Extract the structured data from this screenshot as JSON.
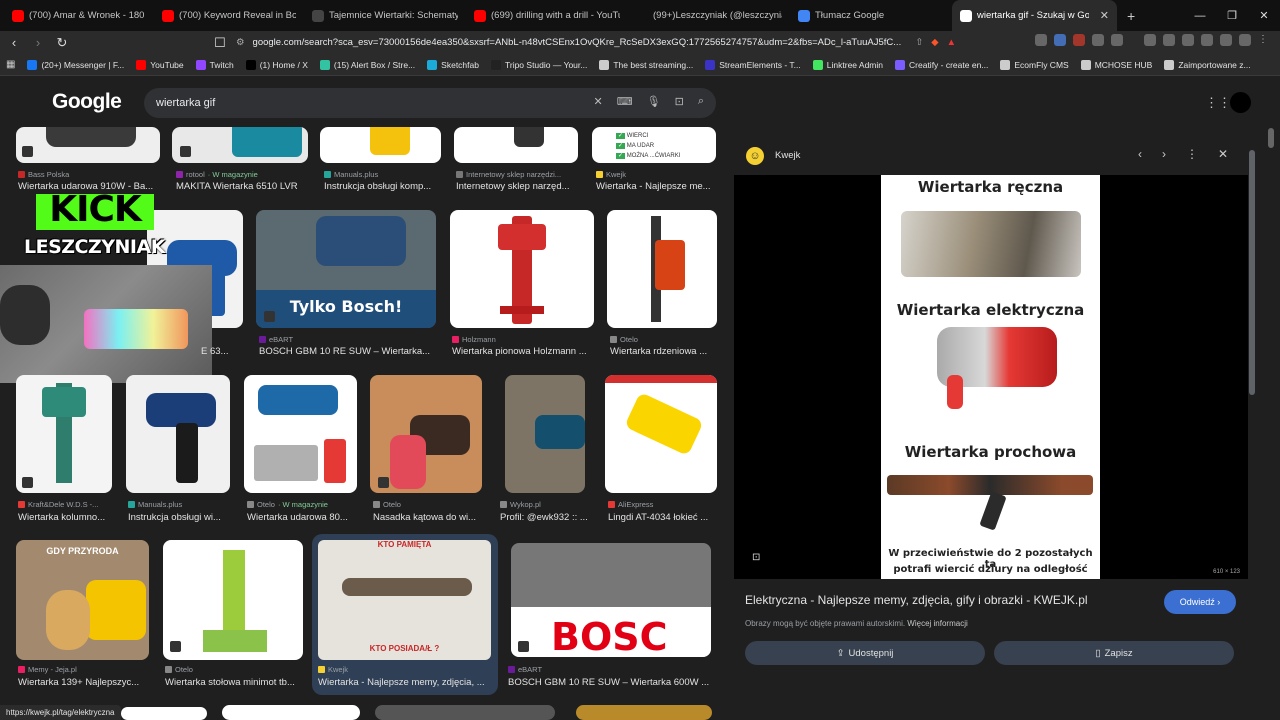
{
  "tabs": [
    {
      "label": "(700) Amar & Wronek - 180 Stop",
      "color": "#ff0000",
      "active": false
    },
    {
      "label": "(700) Keyword Reveal in Book effect",
      "color": "#ff0000",
      "active": false
    },
    {
      "label": "Tajemnice Wiertarki: Schematy, Fizyk",
      "color": "#444444",
      "active": false
    },
    {
      "label": "(699) drilling with a drill - YouTube",
      "color": "#ff0000",
      "active": false
    },
    {
      "label": "(99+)Leszczyniak (@leszczyniak1) | T",
      "color": "#111111",
      "active": false
    },
    {
      "label": "Tłumacz Google",
      "color": "#4285f4",
      "active": false
    },
    {
      "label": "wiertarka gif - Szukaj w Google",
      "color": "#ffffff",
      "active": true
    }
  ],
  "address": {
    "url": "google.com/search?sca_esv=73000156de4ea350&sxsrf=ANbL-n48vtCSEnx1OvQKre_RcSeDX3exGQ:1772565274757&udm=2&fbs=ADc_l-aTuuAJ5fC..."
  },
  "bookmarks": [
    {
      "label": "(20+) Messenger | F...",
      "color": "#1877f2"
    },
    {
      "label": "YouTube",
      "color": "#ff0000"
    },
    {
      "label": "Twitch",
      "color": "#9146ff"
    },
    {
      "label": "(1) Home / X",
      "color": "#000000"
    },
    {
      "label": "(15) Alert Box / Stre...",
      "color": "#31c3a2"
    },
    {
      "label": "Sketchfab",
      "color": "#1caad9"
    },
    {
      "label": "Tripo Studio — Your...",
      "color": "#222222"
    },
    {
      "label": "The best streaming...",
      "color": "#cccccc"
    },
    {
      "label": "StreamElements - T...",
      "color": "#3b32c6"
    },
    {
      "label": "Linktree Admin",
      "color": "#43e660"
    },
    {
      "label": "Creatify - create en...",
      "color": "#7a5cff"
    },
    {
      "label": "EcomFly CMS",
      "color": "#cccccc"
    },
    {
      "label": "MCHOSE HUB",
      "color": "#cccccc"
    },
    {
      "label": "Zaimportowane z...",
      "color": "#cccccc"
    }
  ],
  "search": {
    "logo": "Google",
    "query": "wiertarka gif"
  },
  "overlay": {
    "kick": "KICK",
    "name": "LESZCZYNIAK"
  },
  "results": {
    "row1": [
      {
        "source": "Bass Polska",
        "title": "Wiertarka udarowa 910W - Ba..."
      },
      {
        "source": "rotool",
        "mag": "· W magazynie",
        "title": "MAKITA Wiertarka 6510 LVR"
      },
      {
        "source": "Manuals.plus",
        "title": "Instrukcja obsługi komp..."
      },
      {
        "source": "Internetowy sklep narzędzi...",
        "title": "Internetowy sklep narzęd..."
      },
      {
        "source": "Kwejk",
        "title": "Wiertarka - Najlepsze me..."
      }
    ],
    "row2": [
      {
        "source": "",
        "title": "E 63..."
      },
      {
        "source": "eBART",
        "title": "BOSCH GBM 10 RE SUW – Wiertarka..."
      },
      {
        "source": "Holzmann",
        "title": "Wiertarka pionowa Holzmann ..."
      },
      {
        "source": "Otelo",
        "title": "Wiertarka rdzeniowa ..."
      }
    ],
    "row2_banner": "Tylko Bosch!",
    "row3": [
      {
        "source": "Kraft&Dele W.D.S -...",
        "title": "Wiertarka kolumno..."
      },
      {
        "source": "Manuals.plus",
        "title": "Instrukcja obsługi wi..."
      },
      {
        "source": "Otelo",
        "mag": "· W magazynie",
        "title": "Wiertarka udarowa 80..."
      },
      {
        "source": "Otelo",
        "title": "Nasadka kątowa do wi..."
      },
      {
        "source": "Wykop.pl",
        "title": "Profil: @ewk932 :: ..."
      },
      {
        "source": "AliExpress",
        "title": "Lingdi AT-4034 łokieć ..."
      }
    ],
    "row4": [
      {
        "source": "Memy - Jeja.pl",
        "title": "Wiertarka 139+ Najlepszyc..."
      },
      {
        "source": "Otelo",
        "title": "Wiertarka stołowa minimot tb..."
      },
      {
        "source": "Kwejk",
        "title": "Wiertarka - Najlepsze memy, zdjęcia, ..."
      },
      {
        "source": "eBART",
        "title": "BOSCH GBM 10 RE SUW – Wiertarka 600W ..."
      }
    ],
    "row4_texts": {
      "gdy": "GDY PRZYRODA",
      "kto_top": "KTO PAMIĘTA",
      "kto_bottom": "KTO POSIADA/Ł ?",
      "bosch": "BOSC"
    },
    "row1_check": [
      "WIERCI",
      "MA UDAR",
      "MOŻNA ...ĆWIARKI"
    ]
  },
  "panel": {
    "site": "Kwejk",
    "meme": {
      "line1": "Wiertarka ręczna",
      "line2": "Wiertarka elektryczna",
      "line3": "Wiertarka prochowa",
      "line4": "W przeciwieństwie do 2 pozostałych ta",
      "line5": "potrafi wiercić dziury na odległość"
    },
    "dims": "610 × 123",
    "title": "Elektryczna - Najlepsze memy, zdjęcia, gify i obrazki - KWEJK.pl",
    "visit": "Odwiedź",
    "rights": "Obrazy mogą być objęte prawami autorskimi.",
    "rights_link": "Więcej informacji",
    "share": "Udostępnij",
    "save": "Zapisz"
  },
  "status_url": "https://kwejk.pl/tag/elektryczna"
}
